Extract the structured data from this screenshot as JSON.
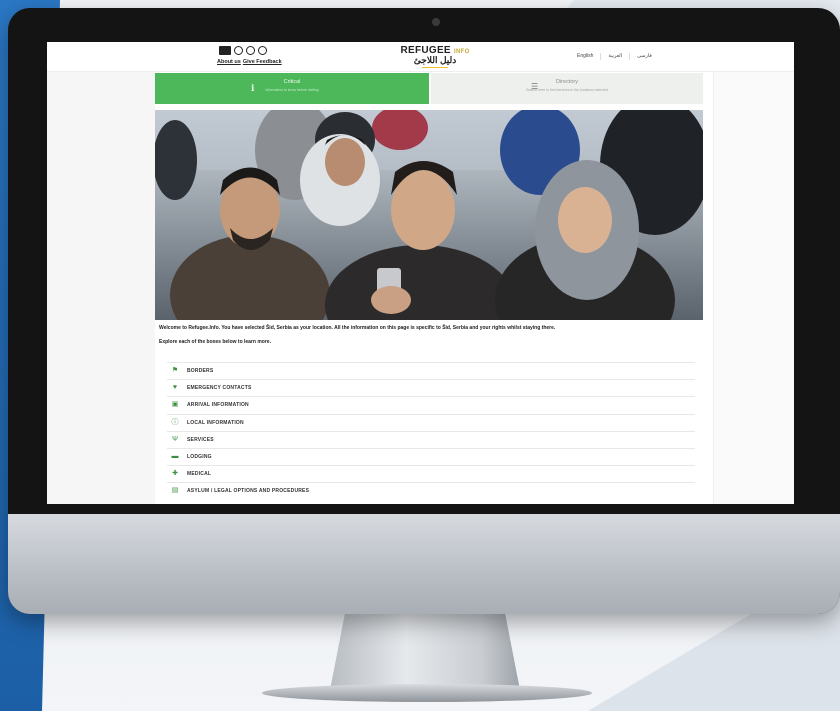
{
  "header": {
    "links": [
      "About us",
      "Give Feedback"
    ],
    "brand_en": "REFUGEE",
    "brand_info": "INFO",
    "brand_ar": "دليل اللاجئ",
    "languages": [
      "English",
      "العربية",
      "فارسی"
    ]
  },
  "tabs": [
    {
      "title": "Critical",
      "subtitle": "Information to know before visiting"
    },
    {
      "title": "Directory",
      "subtitle": "Search here to find services in the locations selected"
    }
  ],
  "welcome_text": "Welcome to Refugee.Info. You have selected Šid, Serbia as your location. All the information on this page is specific to Šid, Serbia and your rights whilst staying there.",
  "explore_text": "Explore each of the boxes below to learn more.",
  "sections": [
    {
      "label": "BORDERS",
      "icon": "signpost-icon"
    },
    {
      "label": "EMERGENCY CONTACTS",
      "icon": "heart-icon"
    },
    {
      "label": "ARRIVAL INFORMATION",
      "icon": "car-icon"
    },
    {
      "label": "LOCAL INFORMATION",
      "icon": "info-icon"
    },
    {
      "label": "SERVICES",
      "icon": "cutlery-icon"
    },
    {
      "label": "LODGING",
      "icon": "bed-icon"
    },
    {
      "label": "MEDICAL",
      "icon": "medkit-icon"
    },
    {
      "label": "ASYLUM / LEGAL OPTIONS AND PROCEDURES",
      "icon": "document-icon"
    }
  ],
  "colors": {
    "accent_green": "#4cb85a",
    "brand_yellow": "#f1c12b"
  }
}
